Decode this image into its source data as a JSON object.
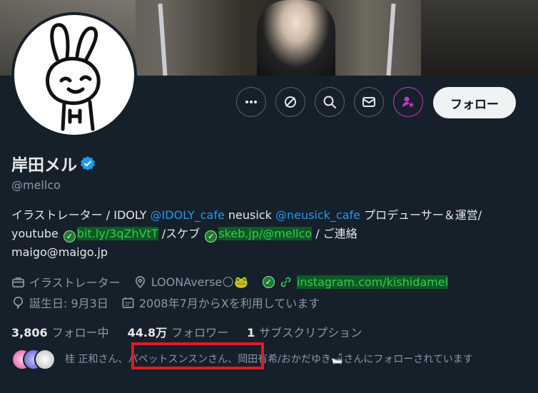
{
  "profile": {
    "name": "岸田メル",
    "handle": "@mellco",
    "follow_label": "フォロー"
  },
  "actions": {
    "more_icon": "more-horizontal-icon",
    "grok_icon": "grok-icon",
    "search_icon": "search-icon",
    "message_icon": "mail-icon",
    "subscribe_icon": "subscribe-icon"
  },
  "bio": {
    "t1": "イラストレーター / IDOLY ",
    "l1": "@IDOLY_cafe",
    "t2": " neusick ",
    "l2": "@neusick_cafe",
    "t3": " プロデューサー＆運営/  youtube ",
    "g1": "bit.ly/3qZhVtT",
    "t4": " /スケブ ",
    "g2": "skeb.jp/@mellco",
    "t5": " / ご連絡",
    "t6": "maigo@maigo.jp"
  },
  "meta": {
    "job": "イラストレーター",
    "location": "LOONAverse🌕🐸",
    "website": "instagram.com/kishidamel",
    "birthday": "誕生日: 9月3日",
    "joined": "2008年7月からXを利用しています"
  },
  "stats": {
    "following_count": "3,806",
    "following_label": "フォロー中",
    "followers_count": "44.8万",
    "followers_label": "フォロワー",
    "subs_count": "1",
    "subs_label": "サブスクリプション"
  },
  "followed_by": {
    "text_a": "桂 正和さん、",
    "text_b": "パペットスンスンさん、",
    "text_c": "岡田有希/おかだゆき🛁さんにフォローされています"
  },
  "colors": {
    "background": "#15202b",
    "accent": "#1d9bf0",
    "highlight_box": "#e11a22"
  }
}
